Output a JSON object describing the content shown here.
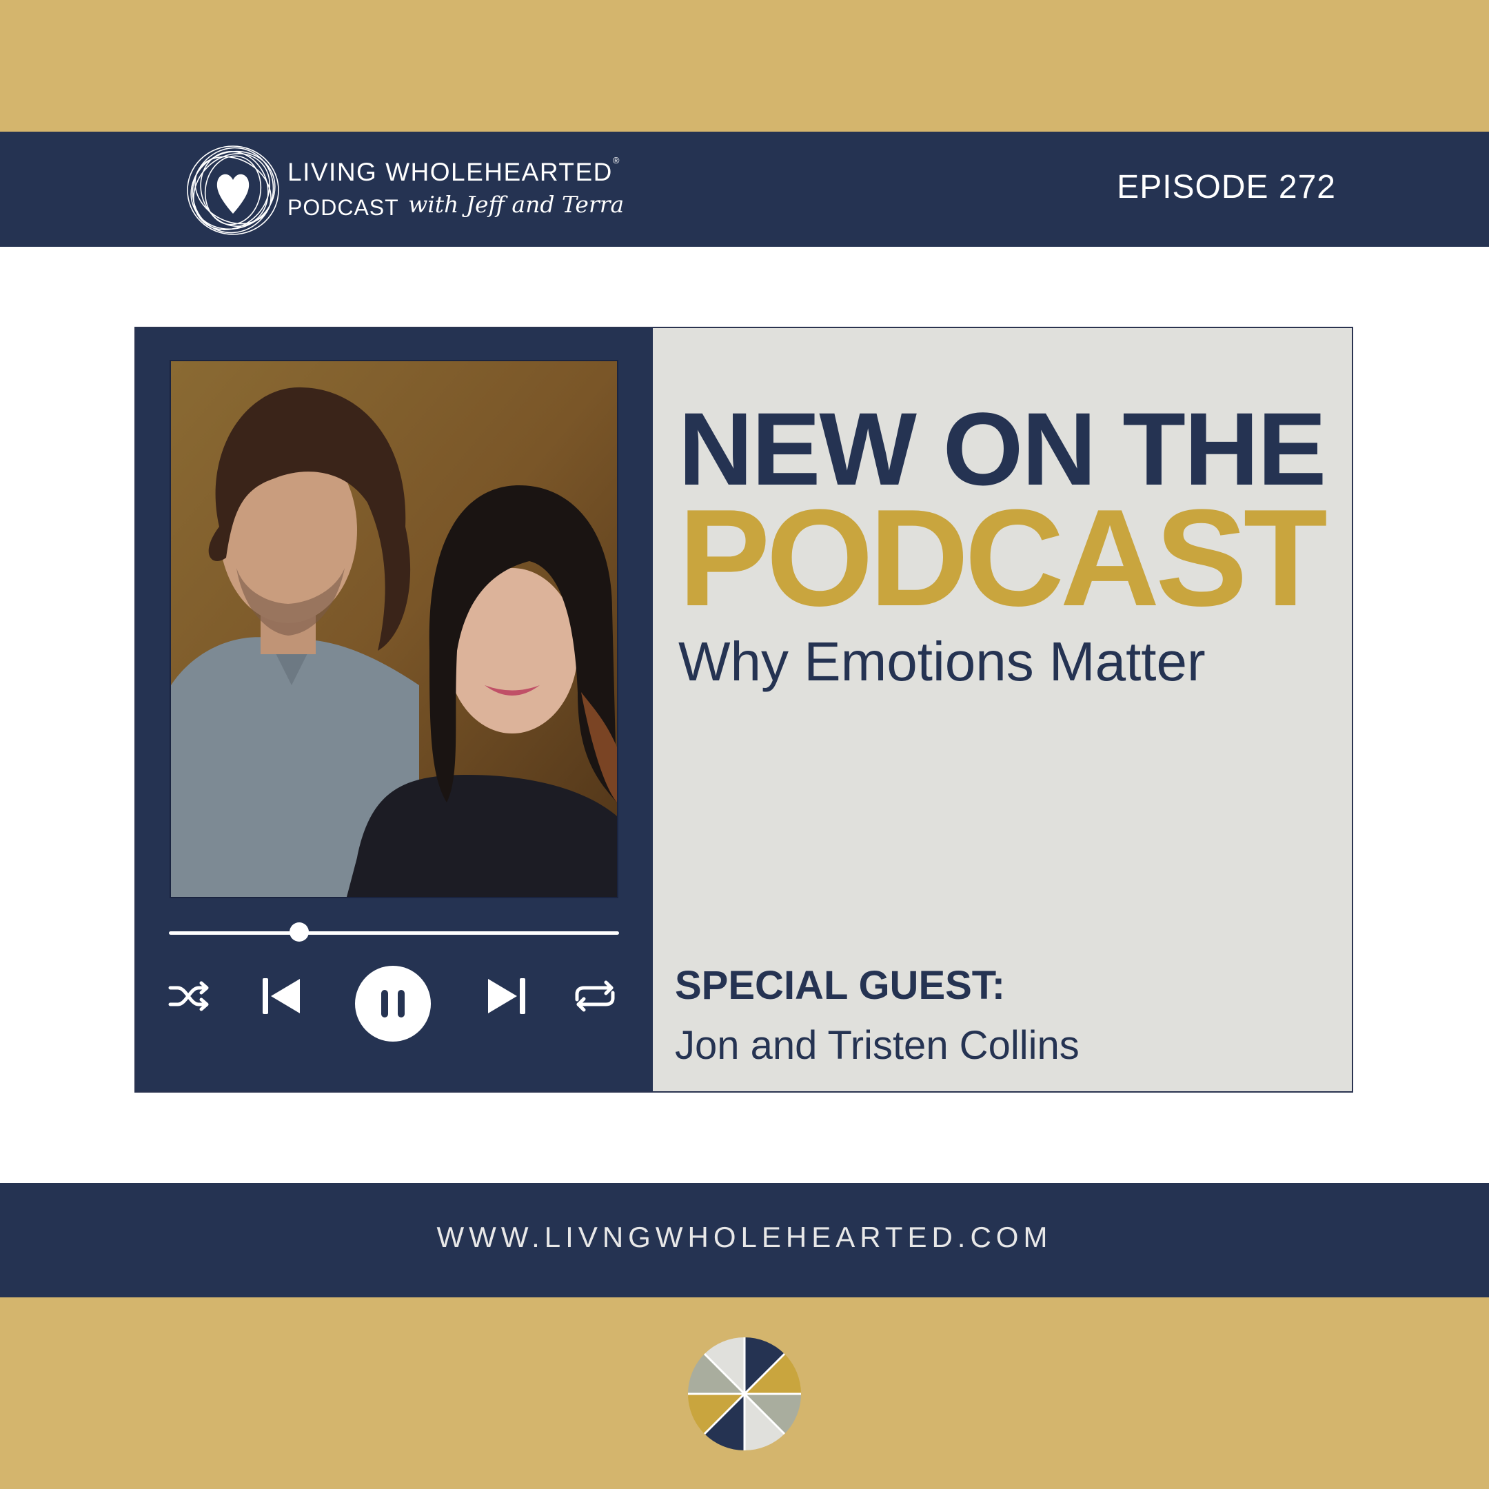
{
  "header": {
    "brand_line1": "LIVING WHOLEHEARTED",
    "registered_mark": "®",
    "brand_line2": "PODCAST",
    "brand_script": "with Jeff and Terra",
    "episode": "EPISODE 272"
  },
  "card": {
    "headline_line1": "NEW ON THE",
    "headline_line2": "PODCAST",
    "subtitle": "Why Emotions Matter",
    "guest_label": "SPECIAL GUEST:",
    "guest_name": "Jon and Tristen Collins"
  },
  "player": {
    "progress_fraction": 0.29,
    "controls": [
      "shuffle-icon",
      "previous-icon",
      "pause-icon",
      "next-icon",
      "repeat-icon"
    ]
  },
  "footer": {
    "website": "WWW.LIVNGWHOLEHEARTED.COM"
  },
  "colors": {
    "gold": "#d4b56d",
    "navy": "#253352",
    "accent_gold": "#c9a53e",
    "card_gray": "#e0e0dc"
  }
}
